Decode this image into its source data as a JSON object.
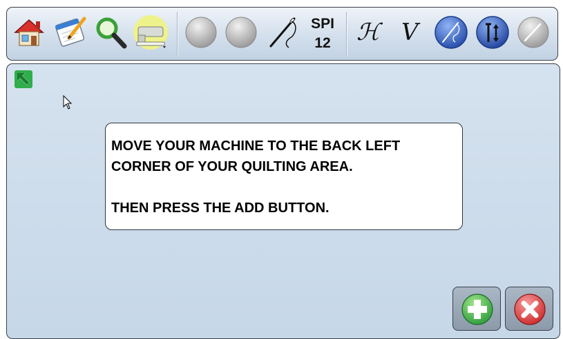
{
  "toolbar": {
    "icons": [
      "home-icon",
      "notepad-icon",
      "magnifier-icon",
      "machine-icon",
      "disabled-circle-icon",
      "disabled-circle-icon",
      "needle-icon",
      "script-h-icon",
      "script-v-icon",
      "needle-blue-icon",
      "tension-icon",
      "disabled-needle-icon"
    ],
    "spi_label": "SPI",
    "spi_value": "12",
    "h_letter": "ℋ",
    "v_letter": "V"
  },
  "main": {
    "message_line1": "MOVE YOUR MACHINE TO THE BACK LEFT CORNER OF YOUR QUILTING AREA.",
    "message_line2": "THEN PRESS THE ADD BUTTON."
  },
  "buttons": {
    "add_icon": "plus-icon",
    "cancel_icon": "x-icon"
  },
  "colors": {
    "toolbar_bg": "#d3dfec",
    "main_bg": "#c9d9ea",
    "add_green": "#3bb54a",
    "cancel_red": "#e03b3b",
    "blue_button": "#3b6fd6",
    "indicator_green": "#2fae4b"
  }
}
